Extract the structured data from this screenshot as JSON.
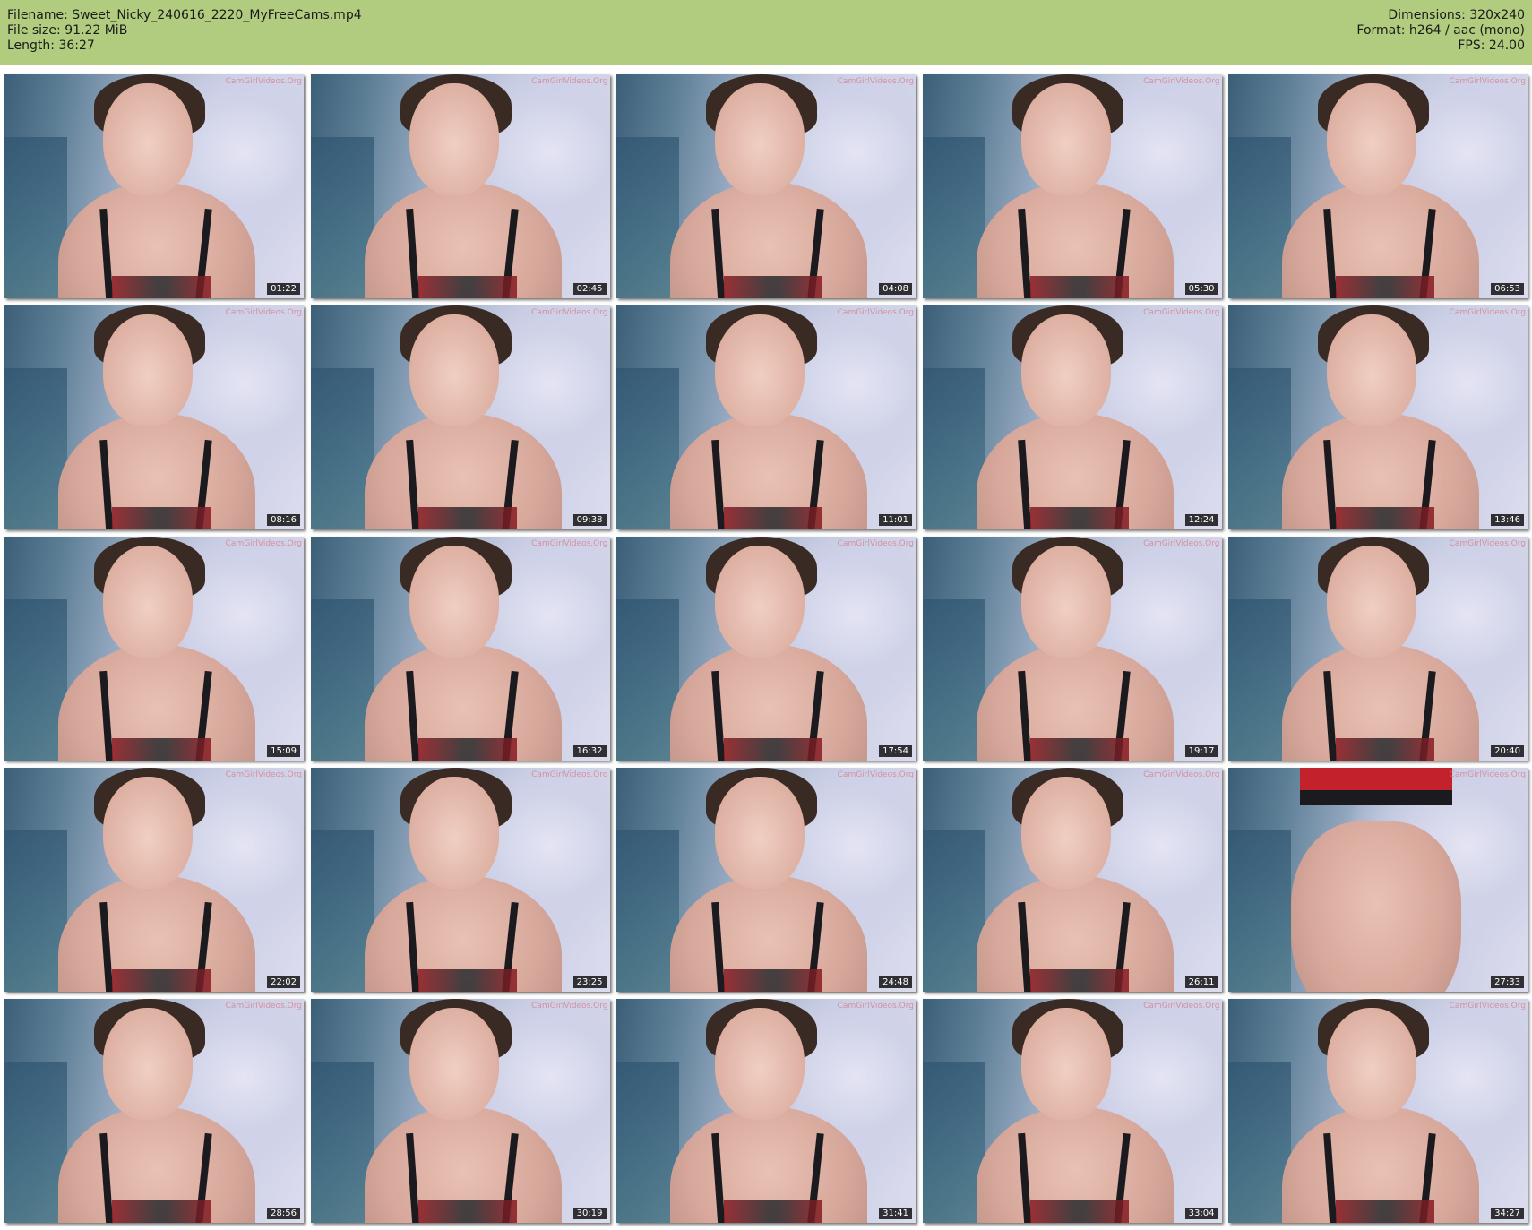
{
  "header": {
    "filename_label": "Filename: Sweet_Nicky_240616_2220_MyFreeCams.mp4",
    "filesize_label": "File size: 91.22 MiB",
    "length_label": "Length: 36:27",
    "dimensions_label": "Dimensions: 320x240",
    "format_label": "Format: h264 / aac (mono)",
    "fps_label": "FPS: 24.00",
    "background_color": "#b2cc7f"
  },
  "thumbnails": [
    {
      "timestamp": "01:22",
      "watermark": "CamGirlVideos.Org"
    },
    {
      "timestamp": "02:45",
      "watermark": "CamGirlVideos.Org"
    },
    {
      "timestamp": "04:08",
      "watermark": "CamGirlVideos.Org"
    },
    {
      "timestamp": "05:30",
      "watermark": "CamGirlVideos.Org"
    },
    {
      "timestamp": "06:53",
      "watermark": "CamGirlVideos.Org"
    },
    {
      "timestamp": "08:16",
      "watermark": "CamGirlVideos.Org"
    },
    {
      "timestamp": "09:38",
      "watermark": "CamGirlVideos.Org"
    },
    {
      "timestamp": "11:01",
      "watermark": "CamGirlVideos.Org"
    },
    {
      "timestamp": "12:24",
      "watermark": "CamGirlVideos.Org"
    },
    {
      "timestamp": "13:46",
      "watermark": "CamGirlVideos.Org"
    },
    {
      "timestamp": "15:09",
      "watermark": "CamGirlVideos.Org"
    },
    {
      "timestamp": "16:32",
      "watermark": "CamGirlVideos.Org"
    },
    {
      "timestamp": "17:54",
      "watermark": "CamGirlVideos.Org"
    },
    {
      "timestamp": "19:17",
      "watermark": "CamGirlVideos.Org"
    },
    {
      "timestamp": "20:40",
      "watermark": "CamGirlVideos.Org"
    },
    {
      "timestamp": "22:02",
      "watermark": "CamGirlVideos.Org"
    },
    {
      "timestamp": "23:25",
      "watermark": "CamGirlVideos.Org"
    },
    {
      "timestamp": "24:48",
      "watermark": "CamGirlVideos.Org"
    },
    {
      "timestamp": "26:11",
      "watermark": "CamGirlVideos.Org"
    },
    {
      "timestamp": "27:33",
      "watermark": "CamGirlVideos.Org",
      "variant": "alt"
    },
    {
      "timestamp": "28:56",
      "watermark": "CamGirlVideos.Org"
    },
    {
      "timestamp": "30:19",
      "watermark": "CamGirlVideos.Org"
    },
    {
      "timestamp": "31:41",
      "watermark": "CamGirlVideos.Org"
    },
    {
      "timestamp": "33:04",
      "watermark": "CamGirlVideos.Org"
    },
    {
      "timestamp": "34:27",
      "watermark": "CamGirlVideos.Org"
    }
  ]
}
